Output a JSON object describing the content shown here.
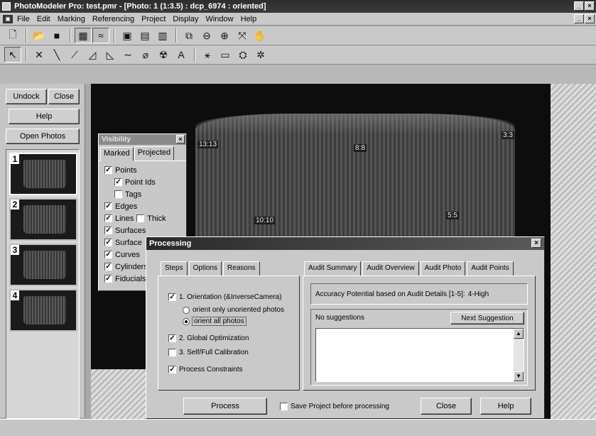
{
  "window": {
    "title": "PhotoModeler Pro: test.pmr - [Photo: 1 (1:3.5) : dcp_6974 : oriented]",
    "minimize": "_",
    "restore": "×",
    "close": "×",
    "menu_minimize": "_",
    "menu_restore": "×"
  },
  "menu": {
    "items": [
      "File",
      "Edit",
      "Marking",
      "Referencing",
      "Project",
      "Display",
      "Window",
      "Help"
    ]
  },
  "left_panel": {
    "undock": "Undock",
    "close": "Close",
    "help": "Help",
    "open_photos": "Open Photos",
    "thumbnails": [
      "1",
      "2",
      "3",
      "4"
    ]
  },
  "image": {
    "point_labels": [
      "13:13",
      "8:8",
      "3:3",
      "10:10",
      "5:5"
    ]
  },
  "visibility": {
    "title": "Visibility",
    "close": "×",
    "tabs": [
      "Marked",
      "Projected"
    ],
    "items": [
      {
        "label": "Points",
        "checked": true
      },
      {
        "label": "Point Ids",
        "checked": true
      },
      {
        "label": "Tags",
        "checked": false
      },
      {
        "label": "Edges",
        "checked": true
      },
      {
        "label": "Lines",
        "checked": true
      },
      {
        "label": "Thick",
        "checked": false
      },
      {
        "label": "Surfaces",
        "checked": true
      },
      {
        "label": "Surface",
        "checked": true
      },
      {
        "label": "Curves",
        "checked": true
      },
      {
        "label": "Cylinders",
        "checked": true
      },
      {
        "label": "Fiducials",
        "checked": true
      }
    ]
  },
  "processing": {
    "title": "Processing",
    "close": "×",
    "left_tabs": [
      "Steps",
      "Options",
      "Reasons"
    ],
    "right_tabs": [
      "Audit Summary",
      "Audit Overview",
      "Audit Photo",
      "Audit Points"
    ],
    "steps": {
      "orientation": "1. Orientation (&InverseCamera)",
      "orient_unoriented": "orient only unoriented photos",
      "orient_all": "orient all photos",
      "global_opt": "2. Global Optimization",
      "self_cal": "3. Self/Full Calibration",
      "constraints": "Process Constraints"
    },
    "accuracy_label": "Accuracy Potential based on Audit Details [1-5]:",
    "accuracy_value": "4-High",
    "no_suggestions": "No suggestions",
    "next_suggestion": "Next Suggestion",
    "process_button": "Process",
    "save_project_label": "Save Project before processing",
    "close_button": "Close",
    "help_button": "Help"
  }
}
